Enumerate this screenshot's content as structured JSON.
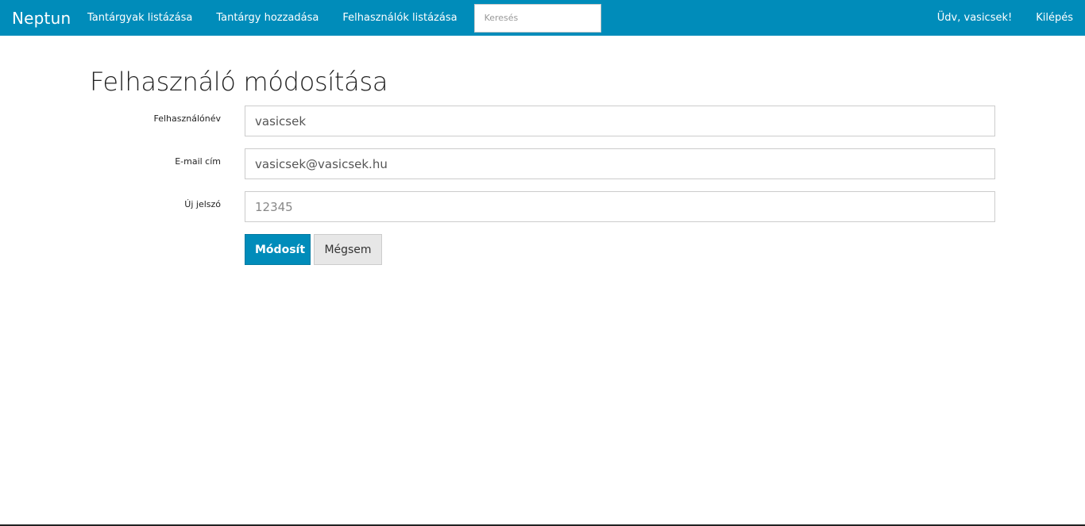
{
  "navbar": {
    "brand": "Neptun",
    "links": [
      "Tantárgyak listázása",
      "Tantárgy hozzadása",
      "Felhasználók listázása"
    ],
    "search_placeholder": "Keresés",
    "greeting": "Üdv, vasicsek!",
    "logout": "Kilépés",
    "color": "#008cba"
  },
  "page": {
    "title": "Felhasználó módosítása"
  },
  "form": {
    "username": {
      "label": "Felhasználónév",
      "value": "vasicsek"
    },
    "email": {
      "label": "E-mail cím",
      "value": "vasicsek@vasicsek.hu"
    },
    "password": {
      "label": "Új jelszó",
      "placeholder": "12345"
    },
    "submit_label": "Módosít",
    "cancel_label": "Mégsem"
  }
}
